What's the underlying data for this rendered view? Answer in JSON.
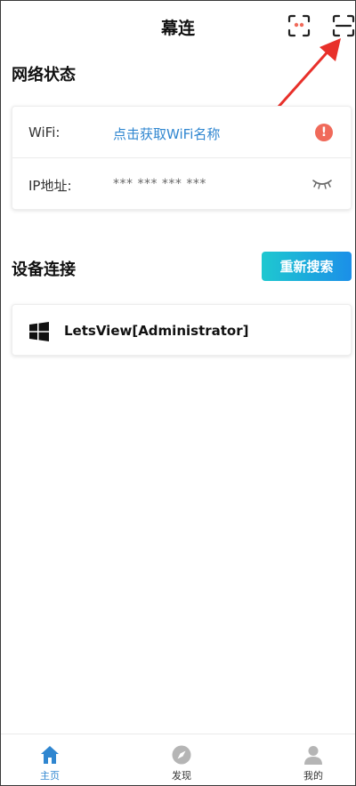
{
  "header": {
    "title": "幕连",
    "cast_icon": "screen-mirror-icon",
    "scan_icon": "scan-icon"
  },
  "network": {
    "section_title": "网络状态",
    "wifi_label": "WiFi:",
    "wifi_value": "点击获取WiFi名称",
    "wifi_status_icon": "warning-icon",
    "ip_label": "IP地址:",
    "ip_value": "*** *** *** ***",
    "visibility_icon": "eye-closed-icon"
  },
  "devices": {
    "section_title": "设备连接",
    "search_button": "重新搜索",
    "items": [
      {
        "icon": "windows-icon",
        "name": "LetsView[Administrator]"
      }
    ]
  },
  "bottom_nav": {
    "items": [
      {
        "label": "主页",
        "icon": "home-icon",
        "active": true
      },
      {
        "label": "发现",
        "icon": "compass-icon",
        "active": false
      },
      {
        "label": "我的",
        "icon": "user-icon",
        "active": false
      }
    ]
  },
  "colors": {
    "accent": "#2f86d0",
    "warning": "#f06a5a",
    "annotation_arrow": "#e8302a",
    "button_gradient_start": "#1ec8d0",
    "button_gradient_end": "#1b8fe8"
  }
}
